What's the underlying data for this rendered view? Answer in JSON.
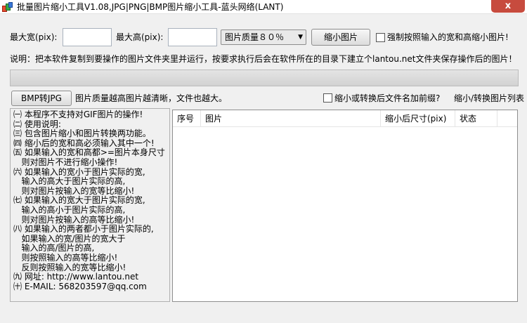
{
  "window": {
    "title": "批量图片缩小工具V1.08,JPG|PNG|BMP图片缩小工具-蓝头网络(LANT)",
    "close_glyph": "x"
  },
  "controls": {
    "max_width_label": "最大宽(pix):",
    "max_width_value": "",
    "max_height_label": "最大高(pix):",
    "max_height_value": "",
    "quality_select": "图片质量８０％",
    "shrink_button": "缩小图片",
    "force_checkbox_label": "强制按照输入的宽和高缩小图片!",
    "force_checked": false
  },
  "instruction": "说明：把本软件复制到要操作的图片文件夹里并运行，按要求执行后会在软件所在的目录下建立个lantou.net文件夹保存操作后的图片！",
  "progress": {
    "value": 0
  },
  "row2": {
    "bmp_button": "BMP转JPG",
    "quality_note": "图片质量越高图片越清晰，文件也越大。",
    "prefix_checkbox_label": "缩小或转换后文件名加前缀?",
    "prefix_checked": false,
    "list_title": "缩小/转换图片列表"
  },
  "info_lines": [
    "㈠ 本程序不支持对GIF图片的操作!",
    "㈡ 使用说明:",
    "㈢ 包含图片缩小和图片转换两功能。",
    "㈣ 缩小后的宽和高必须输入其中一个!",
    "㈤ 如果输入的宽和高都>=图片本身尺寸",
    "   则对图片不进行缩小操作!",
    "㈥ 如果输入的宽小于图片实际的宽,",
    "   输入的高大于图片实际的高,",
    "   则对图片按输入的宽等比缩小!",
    "㈦ 如果输入的宽大于图片实际的宽,",
    "   输入的高小于图片实际的高,",
    "   则对图片按输入的高等比缩小!",
    "㈧ 如果输入的两者都小于图片实际的,",
    "   如果输入的宽/图片的宽大于",
    "   输入的高/图片的高,",
    "   则按照输入的高等比缩小!",
    "   反则按照输入的宽等比缩小!",
    "㈨ 网址: http://www.lantou.net",
    "㈩ E-MAIL: 568203597@qq.com"
  ],
  "table": {
    "columns": [
      "序号",
      "图片",
      "缩小后尺寸(pix)",
      "状态",
      ""
    ],
    "rows": []
  }
}
